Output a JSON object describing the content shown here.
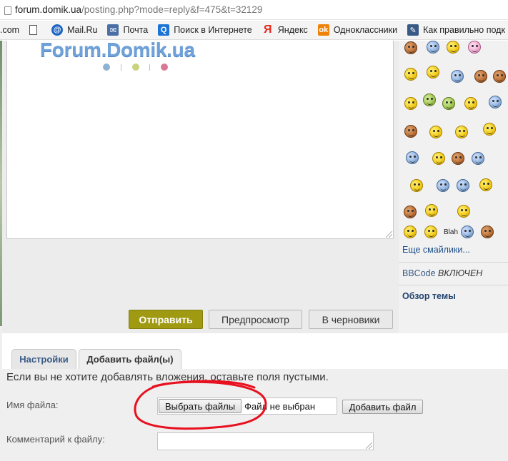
{
  "browser": {
    "url_host": "forum.domik.ua",
    "url_path": "/posting.php?mode=reply&f=475&t=32129"
  },
  "bookmarks": {
    "items": [
      {
        "label": ".com",
        "icon": "none"
      },
      {
        "label": "",
        "icon": "page-icon"
      },
      {
        "label": "Mail.Ru",
        "icon": "mailru-icon"
      },
      {
        "label": "Почта",
        "icon": "mail-icon"
      },
      {
        "label": "Поиск в Интернете",
        "icon": "search-icon"
      },
      {
        "label": "Яндекс",
        "icon": "yandex-icon"
      },
      {
        "label": "Одноклассники",
        "icon": "ok-icon"
      },
      {
        "label": "Как правильно подк",
        "icon": "page-icon"
      }
    ],
    "overflow_glyph": "fl"
  },
  "logo": {
    "text": "Forum.Domik.ua"
  },
  "editor": {
    "buttons": {
      "submit": "Отправить",
      "preview": "Предпросмотр",
      "draft": "В черновики"
    }
  },
  "sidebar": {
    "blah_label": "Blah",
    "more_smilies": "Еще смайлики...",
    "bbcode_prefix": "BBCode",
    "bbcode_state": "ВКЛЮЧЕН",
    "topic_overview": "Обзор темы"
  },
  "tabs": {
    "settings": "Настройки",
    "attach": "Добавить файл(ы)"
  },
  "attachments": {
    "notice": "Если вы не хотите добавлять вложения, оставьте поля пустыми.",
    "filename_label": "Имя файла:",
    "choose_button": "Выбрать файлы",
    "no_file": "Файл не выбран",
    "add_file_button": "Добавить файл",
    "comment_label": "Комментарий к файлу:"
  },
  "colors": {
    "submit_button": "#a09a12",
    "logo": "#6fa1d9",
    "annotation_stroke": "#e8101f",
    "link": "#1f4f8a"
  }
}
